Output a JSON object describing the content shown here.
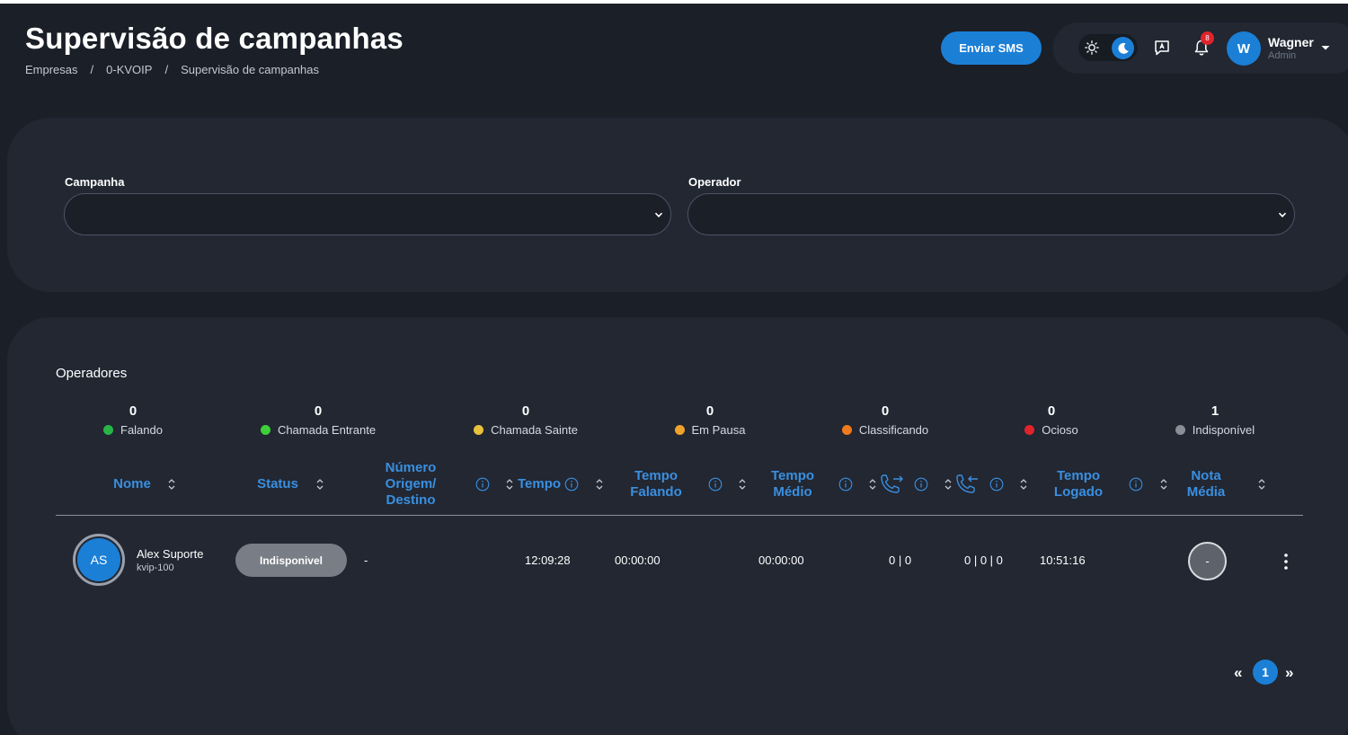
{
  "header": {
    "title": "Supervisão de campanhas",
    "breadcrumb": [
      "Empresas",
      "0-KVOIP",
      "Supervisão de campanhas"
    ],
    "breadcrumb_separator": "/",
    "sms_button": "Enviar SMS"
  },
  "user": {
    "initial": "W",
    "name": "Wagner",
    "role": "Admin",
    "notification_count": "8"
  },
  "filters": {
    "campaign_label": "Campanha",
    "campaign_value": "",
    "operator_label": "Operador",
    "operator_value": ""
  },
  "operators": {
    "title": "Operadores",
    "stats": [
      {
        "count": "0",
        "label": "Falando",
        "color": "#28b446"
      },
      {
        "count": "0",
        "label": "Chamada Entrante",
        "color": "#3fcf3a"
      },
      {
        "count": "0",
        "label": "Chamada Sainte",
        "color": "#e9c13b"
      },
      {
        "count": "0",
        "label": "Em Pausa",
        "color": "#f0a32a"
      },
      {
        "count": "0",
        "label": "Classificando",
        "color": "#f07a1e"
      },
      {
        "count": "0",
        "label": "Ocioso",
        "color": "#e0242c"
      },
      {
        "count": "1",
        "label": "Indisponível",
        "color": "#8a8f97"
      }
    ],
    "columns": {
      "nome": "Nome",
      "status": "Status",
      "numero": "Número Origem/ Destino",
      "tempo": "Tempo",
      "tempo_falando": "Tempo Falando",
      "tempo_medio": "Tempo Médio",
      "tempo_logado": "Tempo Logado",
      "nota_media": "Nota Média"
    },
    "rows": [
      {
        "initials": "AS",
        "name": "Alex Suporte",
        "extension": "kvip-100",
        "status": "Indisponivel",
        "numero": "-",
        "tempo": "12:09:28",
        "tempo_falando": "00:00:00",
        "tempo_medio": "00:00:00",
        "saintes": "0 | 0",
        "entrantes": "0 | 0 | 0",
        "tempo_logado": "10:51:16",
        "nota": "-"
      }
    ]
  },
  "pagination": {
    "prev": "«",
    "current": "1",
    "next": "»"
  },
  "colors": {
    "accent": "#1b7fd6",
    "header_text": "#3a8fe0",
    "background": "#1b1f28",
    "card": "#222732"
  }
}
